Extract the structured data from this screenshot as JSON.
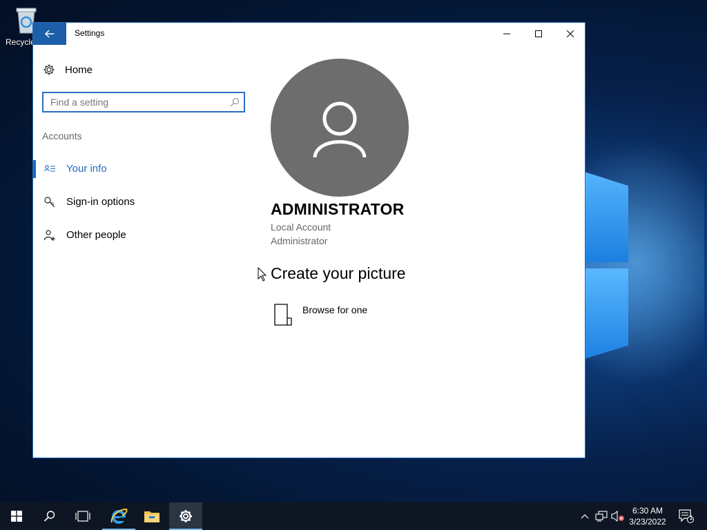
{
  "desktop": {
    "recycle_bin_label": "Recycle Bin"
  },
  "window": {
    "title": "Settings",
    "back_icon": "arrow-left-icon",
    "controls": [
      "minimize-icon",
      "maximize-icon",
      "close-icon"
    ]
  },
  "sidebar": {
    "home_label": "Home",
    "search_placeholder": "Find a setting",
    "section_label": "Accounts",
    "items": [
      {
        "label": "Your info",
        "icon": "contact-card-icon",
        "active": true
      },
      {
        "label": "Sign-in options",
        "icon": "key-icon",
        "active": false
      },
      {
        "label": "Other people",
        "icon": "add-person-icon",
        "active": false
      }
    ]
  },
  "main": {
    "user_name": "ADMINISTRATOR",
    "account_type": "Local Account",
    "account_role": "Administrator",
    "create_picture_heading": "Create your picture",
    "browse_label": "Browse for one"
  },
  "taskbar": {
    "apps": [
      "start-icon",
      "search-icon",
      "task-view-icon",
      "internet-explorer-icon",
      "file-explorer-icon",
      "settings-icon"
    ],
    "time": "6:30 AM",
    "date": "3/23/2022",
    "notification_count": "1"
  },
  "colors": {
    "accent": "#1c6cc1",
    "back_button": "#1c5fa8",
    "avatar_bg": "#6d6d6d",
    "taskbar_bg": "#0d1622"
  }
}
